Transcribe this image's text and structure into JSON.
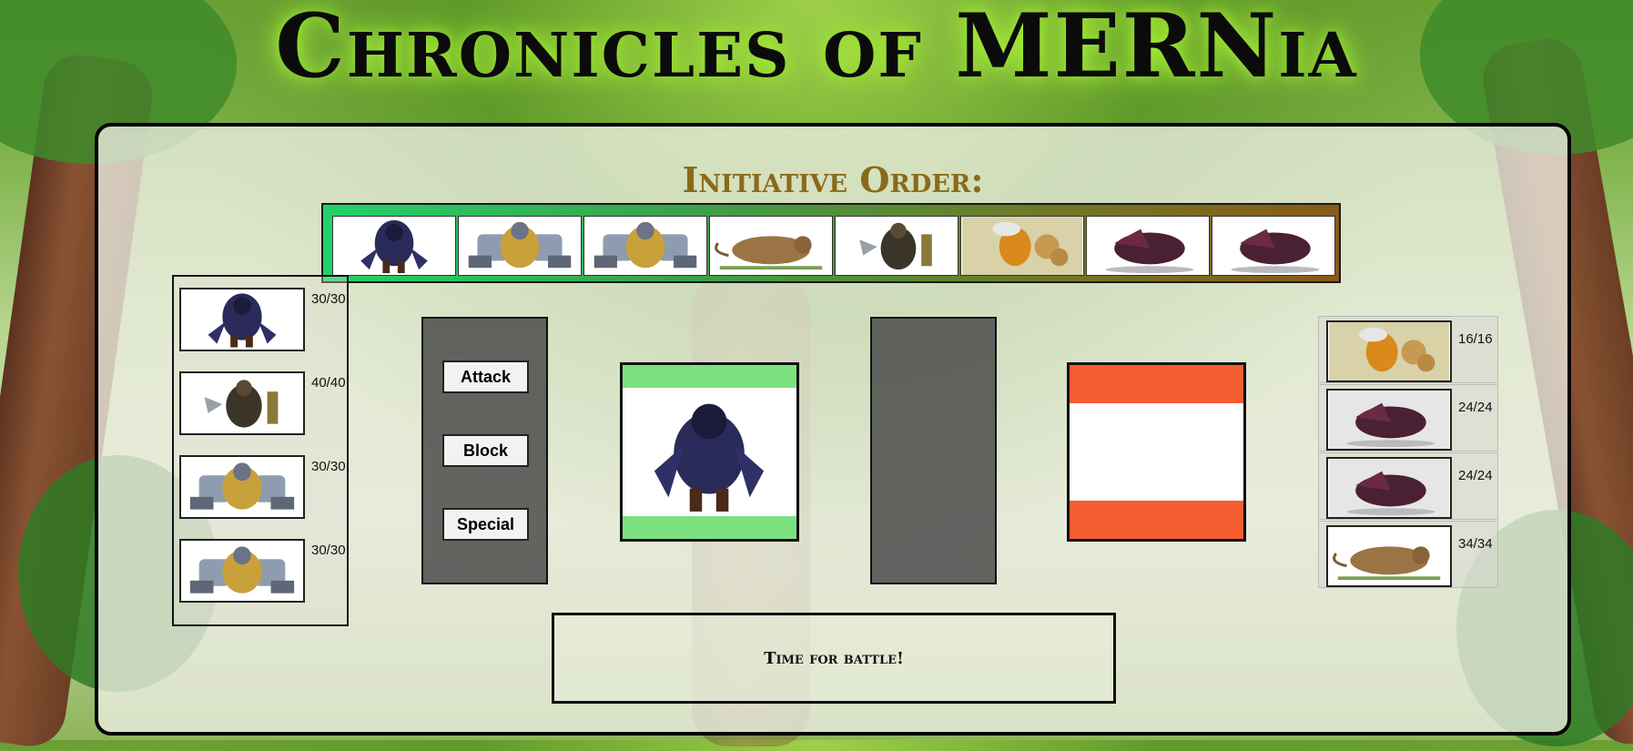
{
  "title": "Chronicles of MERNia",
  "initiative": {
    "title": "Initiative Order:",
    "order": [
      {
        "unit": "Hooded Rogue",
        "sprite": "rogue"
      },
      {
        "unit": "Armored Dwarf",
        "sprite": "dwarf"
      },
      {
        "unit": "Armored Dwarf",
        "sprite": "dwarf"
      },
      {
        "unit": "Giant Rat",
        "sprite": "rat"
      },
      {
        "unit": "Axe Warrior",
        "sprite": "warrior"
      },
      {
        "unit": "Giant Wasp",
        "sprite": "wasp"
      },
      {
        "unit": "Dark Harpy",
        "sprite": "harpy"
      },
      {
        "unit": "Dark Harpy",
        "sprite": "harpy"
      }
    ]
  },
  "party": [
    {
      "sprite": "rogue",
      "hp": "30/30"
    },
    {
      "sprite": "warrior",
      "hp": "40/40"
    },
    {
      "sprite": "dwarf",
      "hp": "30/30"
    },
    {
      "sprite": "dwarf",
      "hp": "30/30"
    }
  ],
  "actions": {
    "attack": "Attack",
    "block": "Block",
    "special": "Special"
  },
  "active_player": {
    "sprite": "rogue"
  },
  "enemies": [
    {
      "sprite": "wasp",
      "hp": "16/16"
    },
    {
      "sprite": "harpy",
      "hp": "24/24"
    },
    {
      "sprite": "harpy",
      "hp": "24/24"
    },
    {
      "sprite": "rat",
      "hp": "34/34"
    }
  ],
  "battle_log": {
    "message": "Time for battle!"
  },
  "colors": {
    "player_card": "#7de080",
    "enemy_card": "#f55d32",
    "initiative_start": "#21d36a",
    "initiative_end": "#8a5a18"
  }
}
